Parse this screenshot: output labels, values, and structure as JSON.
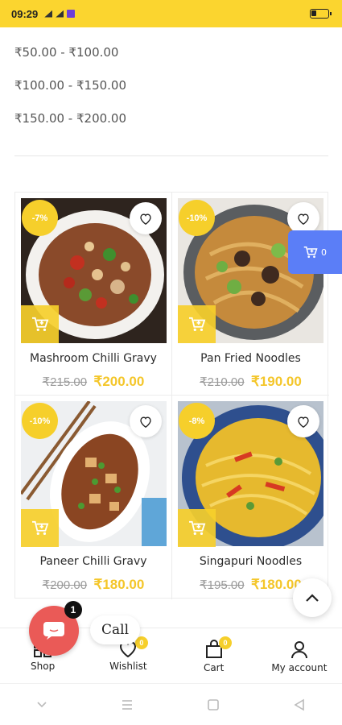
{
  "status_bar": {
    "time": "09:29"
  },
  "price_ranges": [
    "₹50.00 - ₹100.00",
    "₹100.00 - ₹150.00",
    "₹150.00 - ₹200.00"
  ],
  "products": [
    {
      "name": "Mashroom Chilli Gravy",
      "discount": "-7%",
      "old_price": "₹215.00",
      "new_price": "₹200.00"
    },
    {
      "name": "Pan Fried Noodles",
      "discount": "-10%",
      "old_price": "₹210.00",
      "new_price": "₹190.00"
    },
    {
      "name": "Paneer Chilli Gravy",
      "discount": "-10%",
      "old_price": "₹200.00",
      "new_price": "₹180.00"
    },
    {
      "name": "Singapuri Noodles",
      "discount": "-8%",
      "old_price": "₹195.00",
      "new_price": "₹180.00"
    }
  ],
  "floating_cart": {
    "count": "0"
  },
  "call_widget": {
    "badge": "1",
    "label": "Call"
  },
  "bottom_nav": {
    "shop": "Shop",
    "wishlist": "Wishlist",
    "wishlist_count": "0",
    "cart": "Cart",
    "cart_count": "0",
    "account": "My account"
  },
  "colors": {
    "accent": "#fbd52f",
    "sale": "#f4c62a",
    "floating_cart": "#5b7ef7",
    "call": "#ea5a57"
  }
}
